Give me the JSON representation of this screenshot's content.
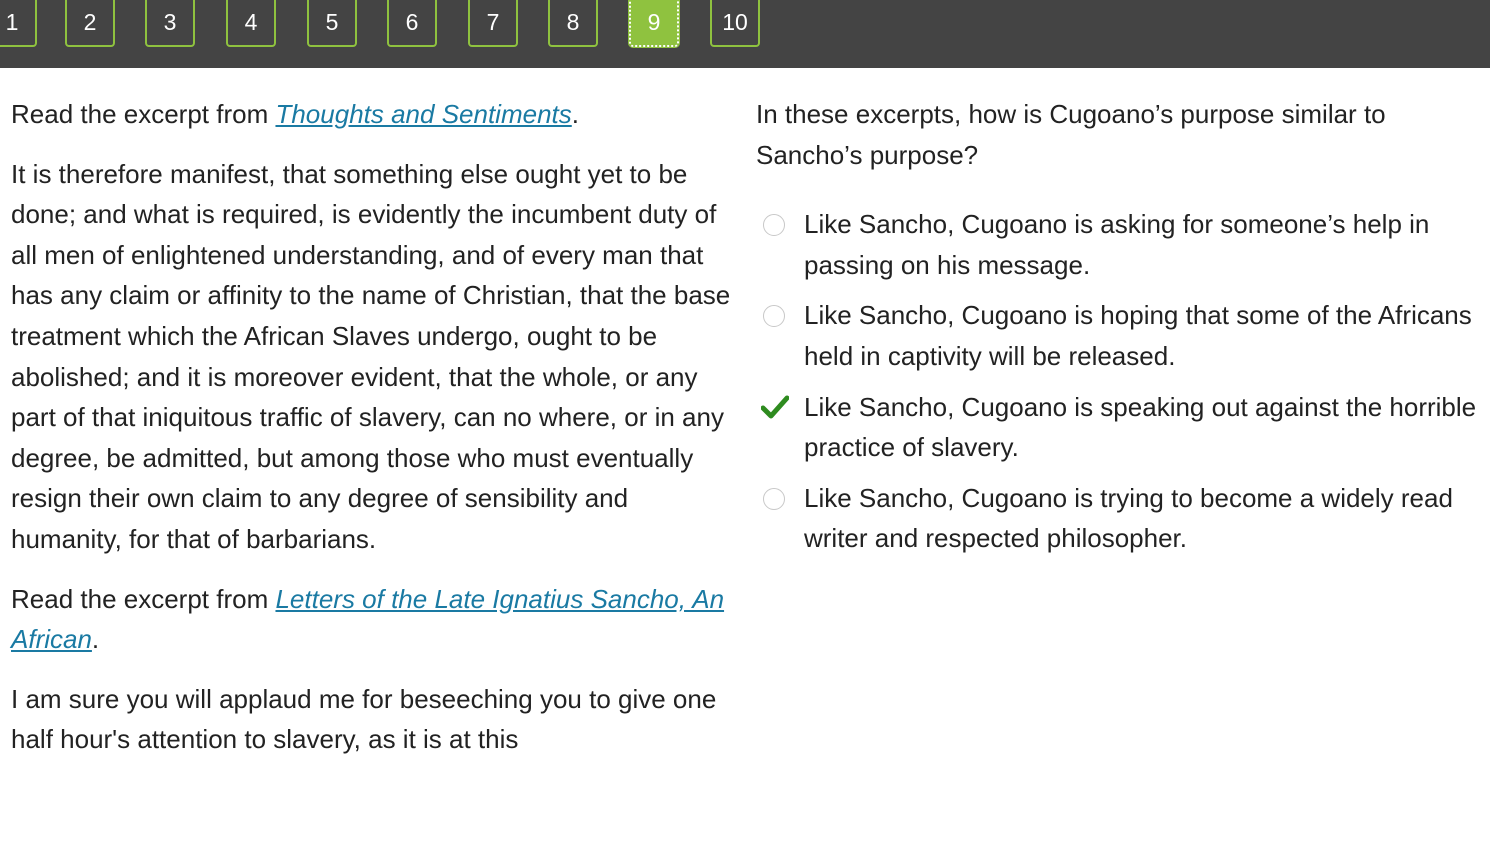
{
  "nav": {
    "questions": [
      "1",
      "2",
      "3",
      "4",
      "5",
      "6",
      "7",
      "8",
      "9",
      "10"
    ],
    "active": "9"
  },
  "left": {
    "excerpt1_prefix": "Read the excerpt from ",
    "excerpt1_title": "Thoughts and Sentiments",
    "excerpt1_suffix": ".",
    "excerpt1_body": "It is therefore manifest, that something else ought yet to be done; and what is required, is evidently the incumbent duty of all men of enlightened understanding, and of every man that has any claim or affinity to the name of Christian, that the base treatment which the African Slaves undergo, ought to be abolished; and it is moreover evident, that the whole, or any part of that iniquitous traffic of slavery, can no where, or in any degree, be admitted, but among those who must eventually resign their own claim to any degree of sensibility and humanity, for that of barbarians.",
    "excerpt2_prefix": "Read the excerpt from ",
    "excerpt2_title": "Letters of the Late Ignatius Sancho, An African",
    "excerpt2_suffix": ".",
    "excerpt2_body": "I am sure you will applaud me for beseeching you to give one half hour's attention to slavery, as it is at this"
  },
  "right": {
    "question": "In these excerpts, how is Cugoano’s purpose similar to Sancho’s purpose?",
    "options": [
      {
        "text": "Like Sancho, Cugoano is asking for someone’s help in passing on his message.",
        "state": "unselected"
      },
      {
        "text": "Like Sancho, Cugoano is hoping that some of the Africans held in captivity will be released.",
        "state": "unselected"
      },
      {
        "text": "Like Sancho, Cugoano is speaking out against the horrible practice of slavery.",
        "state": "correct"
      },
      {
        "text": "Like Sancho, Cugoano is trying to become a widely read writer and respected philosopher.",
        "state": "unselected"
      }
    ]
  },
  "colors": {
    "topbar": "#444444",
    "accent_green": "#8fc23f",
    "check_green": "#2e8b1f",
    "link": "#1a7aa3"
  }
}
